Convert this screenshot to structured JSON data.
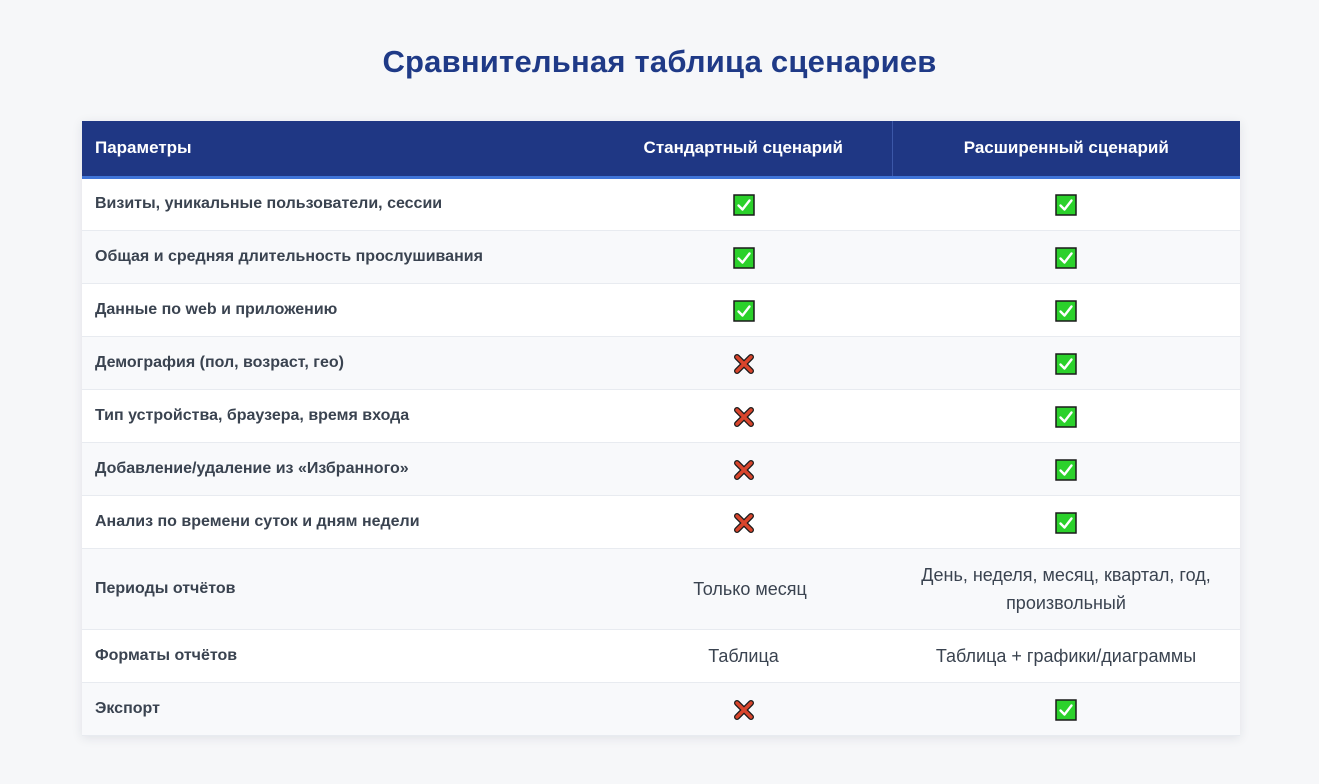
{
  "title": "Сравнительная таблица сценариев",
  "columns": {
    "params": "Параметры",
    "standard": "Стандартный сценарий",
    "extended": "Расширенный сценарий"
  },
  "rows": [
    {
      "label": "Визиты, уникальные пользователи, сессии",
      "standard": {
        "type": "icon",
        "icon": "check-icon"
      },
      "extended": {
        "type": "icon",
        "icon": "check-icon"
      }
    },
    {
      "label": "Общая и средняя длительность прослушивания",
      "standard": {
        "type": "icon",
        "icon": "check-icon"
      },
      "extended": {
        "type": "icon",
        "icon": "check-icon"
      }
    },
    {
      "label": "Данные по web и приложению",
      "standard": {
        "type": "icon",
        "icon": "check-icon"
      },
      "extended": {
        "type": "icon",
        "icon": "check-icon"
      }
    },
    {
      "label": "Демография (пол, возраст, гео)",
      "standard": {
        "type": "icon",
        "icon": "cross-icon"
      },
      "extended": {
        "type": "icon",
        "icon": "check-icon"
      }
    },
    {
      "label": "Тип устройства, браузера, время входа",
      "standard": {
        "type": "icon",
        "icon": "cross-icon"
      },
      "extended": {
        "type": "icon",
        "icon": "check-icon"
      }
    },
    {
      "label": "Добавление/удаление из «Избранного»",
      "standard": {
        "type": "icon",
        "icon": "cross-icon"
      },
      "extended": {
        "type": "icon",
        "icon": "check-icon"
      }
    },
    {
      "label": "Анализ по времени суток и дням недели",
      "standard": {
        "type": "icon",
        "icon": "cross-icon"
      },
      "extended": {
        "type": "icon",
        "icon": "check-icon"
      }
    },
    {
      "label": "Периоды отчётов",
      "standard": {
        "type": "text",
        "text": "Только месяц"
      },
      "extended": {
        "type": "text",
        "text": "День, неделя, месяц, квартал, год, произвольный"
      }
    },
    {
      "label": "Форматы отчётов",
      "standard": {
        "type": "text",
        "text": "Таблица"
      },
      "extended": {
        "type": "text",
        "text": "Таблица + графики/диаграммы"
      }
    },
    {
      "label": "Экспорт",
      "standard": {
        "type": "icon",
        "icon": "cross-icon"
      },
      "extended": {
        "type": "icon",
        "icon": "check-icon"
      }
    }
  ],
  "colors": {
    "title": "#1f3a87",
    "header_bg": "#1f3784",
    "header_accent": "#3f74d8",
    "check_green": "#2bd12b",
    "cross_red": "#d9452c"
  }
}
